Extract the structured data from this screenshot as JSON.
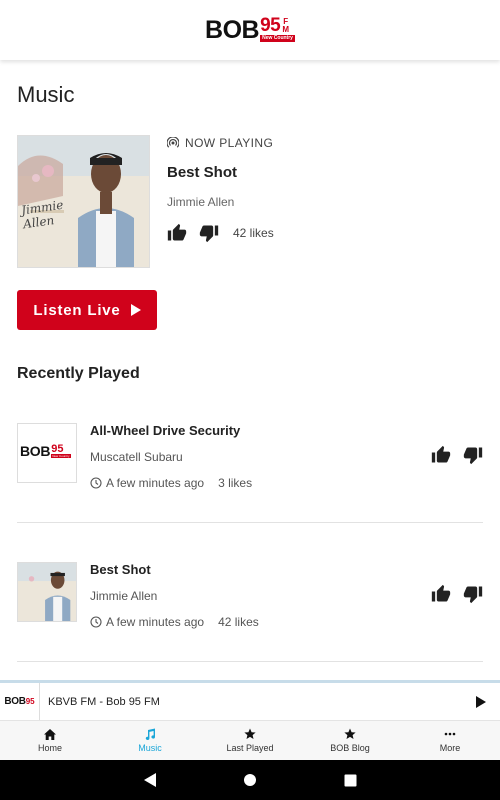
{
  "header": {
    "logo_main": "BOB",
    "logo_number": "95",
    "logo_fm": "FM",
    "logo_subtitle": "New Country"
  },
  "page": {
    "title": "Music"
  },
  "now_playing": {
    "label": "NOW PLAYING",
    "title": "Best Shot",
    "artist": "Jimmie Allen",
    "likes": "42 likes",
    "album_text": "Jimmie Allen"
  },
  "listen_button": {
    "label": "Listen Live"
  },
  "recently_played": {
    "title": "Recently Played",
    "items": [
      {
        "title": "All-Wheel Drive Security",
        "artist": "Muscatell Subaru",
        "time": "A few minutes ago",
        "likes": "3 likes"
      },
      {
        "title": "Best Shot",
        "artist": "Jimmie Allen",
        "time": "A few minutes ago",
        "likes": "42 likes"
      }
    ]
  },
  "mini_player": {
    "title": "KBVB FM - Bob 95 FM"
  },
  "tabs": [
    {
      "label": "Home",
      "icon": "home-icon"
    },
    {
      "label": "Music",
      "icon": "music-note-icon",
      "active": true
    },
    {
      "label": "Last Played",
      "icon": "star-icon"
    },
    {
      "label": "BOB Blog",
      "icon": "star-icon"
    },
    {
      "label": "More",
      "icon": "more-dots-icon"
    }
  ],
  "colors": {
    "brand_red": "#d0021b",
    "active_tab": "#1aa6d8",
    "mini_player_border": "#c7dce9"
  }
}
